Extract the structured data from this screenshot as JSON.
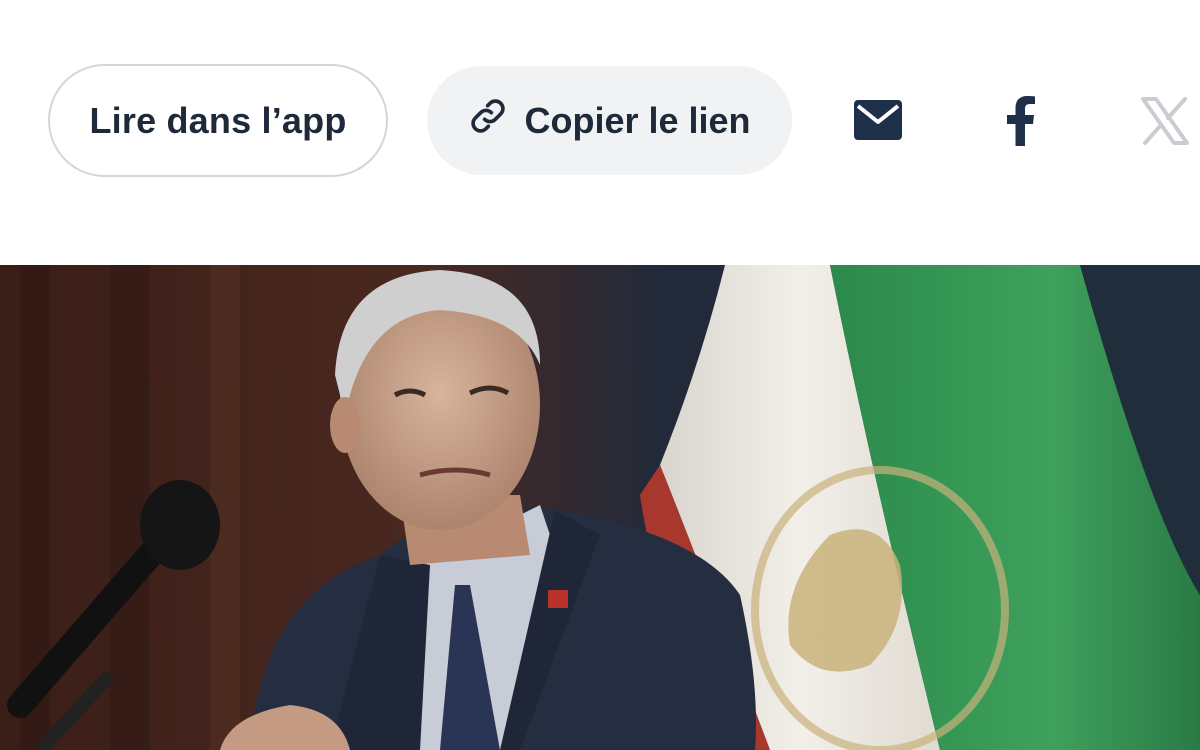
{
  "share": {
    "read_in_app_label": "Lire dans l’app",
    "copy_link_label": "Copier le lien",
    "icons": {
      "link": "link-icon",
      "mail": "mail-icon",
      "facebook": "facebook-icon",
      "x": "x-icon"
    }
  },
  "hero": {
    "image": "photo-man-at-microphone-with-flag"
  },
  "colors": {
    "text": "#1e2a3a",
    "button_border": "#d3d6da",
    "button_fill": "#f1f2f4",
    "icon_disabled": "#c9cdd2"
  }
}
